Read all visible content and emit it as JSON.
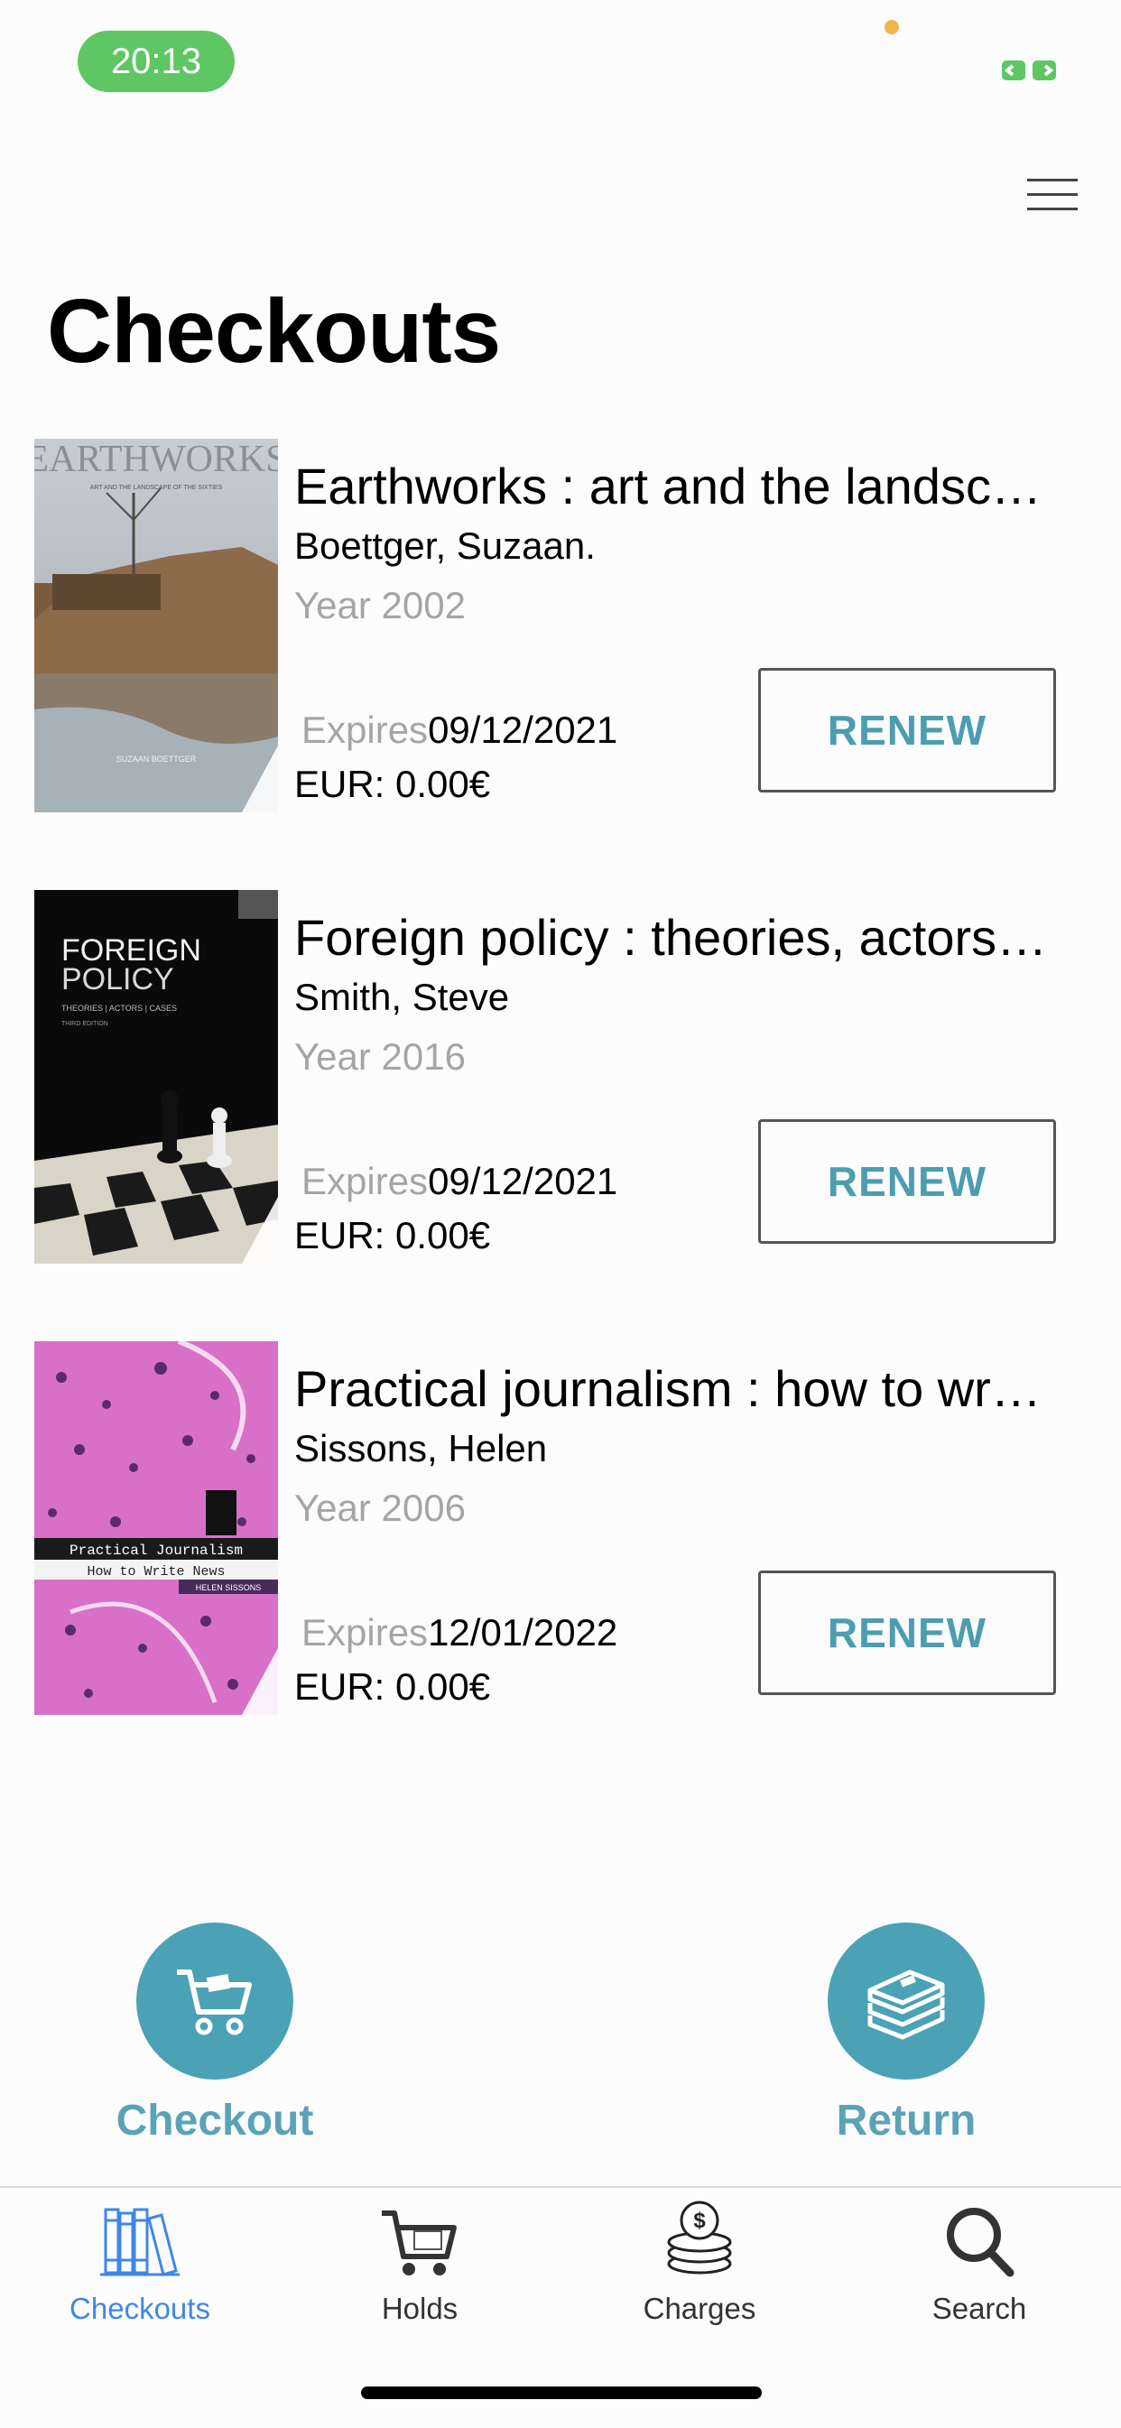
{
  "status_bar": {
    "time": "20:13"
  },
  "page": {
    "title": "Checkouts"
  },
  "checkouts": [
    {
      "title": "Earthworks : art and the landsc…",
      "author": "Boettger, Suzaan.",
      "year": "Year 2002",
      "expires_label": "Expires",
      "expires_date": "09/12/2021",
      "fee": "EUR: 0.00€",
      "renew_label": "RENEW",
      "cover_text": {
        "main": "EARTHWORKS",
        "sub": "ART AND THE LANDSCAPE OF THE SIXTIES",
        "author": "SUZAAN BOETTGER"
      }
    },
    {
      "title": "Foreign policy : theories, actors…",
      "author": "Smith, Steve",
      "year": "Year 2016",
      "expires_label": "Expires",
      "expires_date": "09/12/2021",
      "fee": "EUR: 0.00€",
      "renew_label": "RENEW",
      "cover_text": {
        "main1": "FOREIGN",
        "main2": "POLICY",
        "sub": "THEORIES | ACTORS | CASES",
        "edition": "THIRD EDITION"
      }
    },
    {
      "title": "Practical journalism : how to wr…",
      "author": "Sissons, Helen",
      "year": "Year 2006",
      "expires_label": "Expires",
      "expires_date": "12/01/2022",
      "fee": "EUR: 0.00€",
      "renew_label": "RENEW",
      "cover_text": {
        "main": "Practical Journalism",
        "sub": "How to Write News",
        "author": "HELEN SISSONS"
      }
    }
  ],
  "actions": {
    "checkout_label": "Checkout",
    "return_label": "Return"
  },
  "tabs": [
    {
      "label": "Checkouts",
      "icon": "books-icon",
      "active": true
    },
    {
      "label": "Holds",
      "icon": "cart-icon",
      "active": false
    },
    {
      "label": "Charges",
      "icon": "coins-icon",
      "active": false
    },
    {
      "label": "Search",
      "icon": "search-icon",
      "active": false
    }
  ],
  "colors": {
    "accent": "#4ba2b5",
    "tab_active": "#3f87e6",
    "status_green": "#5ec764"
  }
}
